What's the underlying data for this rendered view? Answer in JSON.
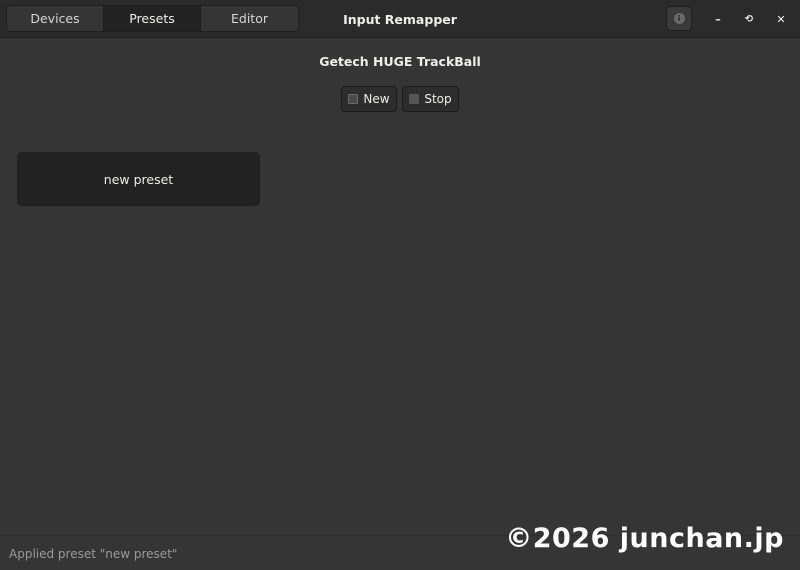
{
  "header": {
    "tabs": [
      {
        "label": "Devices"
      },
      {
        "label": "Presets"
      },
      {
        "label": "Editor"
      }
    ],
    "title": "Input Remapper",
    "info_glyph": "i",
    "minimize_glyph": "–",
    "maximize_glyph": "⟲",
    "close_glyph": "✕"
  },
  "main": {
    "device_name": "Getech HUGE TrackBall",
    "new_button_label": "New",
    "stop_button_label": "Stop",
    "presets": [
      {
        "name": "new preset"
      }
    ]
  },
  "status": {
    "message": "Applied preset \"new preset\""
  },
  "watermark": "©2026 junchan.jp",
  "colors": {
    "window_bg": "#353535",
    "headerbar_bg": "#2b2b2b",
    "active_tab_bg": "#232323",
    "card_bg": "#222222"
  }
}
